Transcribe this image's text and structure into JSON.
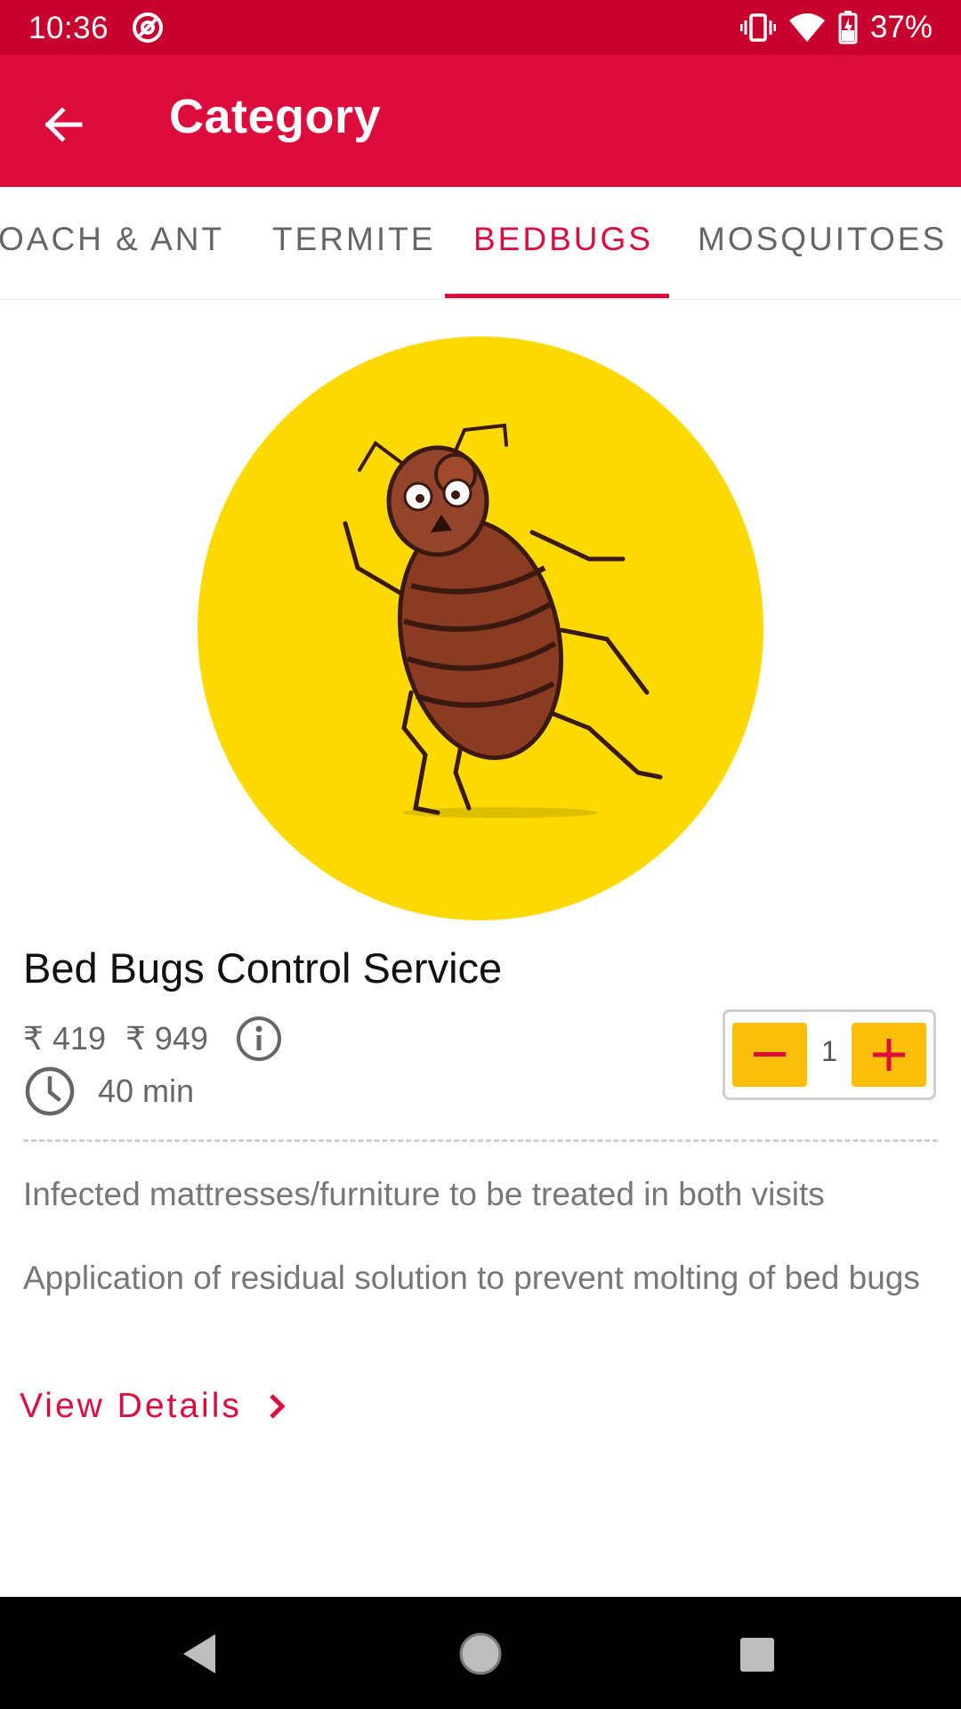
{
  "status_bar": {
    "time": "10:36",
    "battery": "37%",
    "icons": [
      "at-sign-icon",
      "vibrate-icon",
      "wifi-icon",
      "battery-charging-icon"
    ]
  },
  "app_bar": {
    "title": "Category",
    "back_icon": "arrow-left-icon"
  },
  "tabs": [
    {
      "label": "COCKROACH & ANT",
      "visible_label": "OACH & ANT",
      "active": false
    },
    {
      "label": "TERMITE",
      "active": false
    },
    {
      "label": "BEDBUGS",
      "active": true
    },
    {
      "label": "MOSQUITOES",
      "active": false
    }
  ],
  "product": {
    "image_icon": "bedbug-illustration",
    "title": "Bed Bugs Control Service",
    "price": "₹ 419",
    "original_price": "₹ 949",
    "duration": "40 min",
    "quantity": "1",
    "descriptions": [
      "Infected mattresses/furniture to be treated in both visits",
      "Application of residual solution to prevent molting of bed bugs"
    ],
    "view_details_label": "View Details"
  },
  "colors": {
    "status_bar": "#c8002e",
    "app_bar": "#dc0d3d",
    "accent": "#dc0d3d",
    "stepper_button": "#fbbf0b",
    "hero_background": "#fcd900"
  },
  "nav_bar": {
    "icons": [
      "back-triangle-icon",
      "home-circle-icon",
      "recents-square-icon"
    ]
  }
}
